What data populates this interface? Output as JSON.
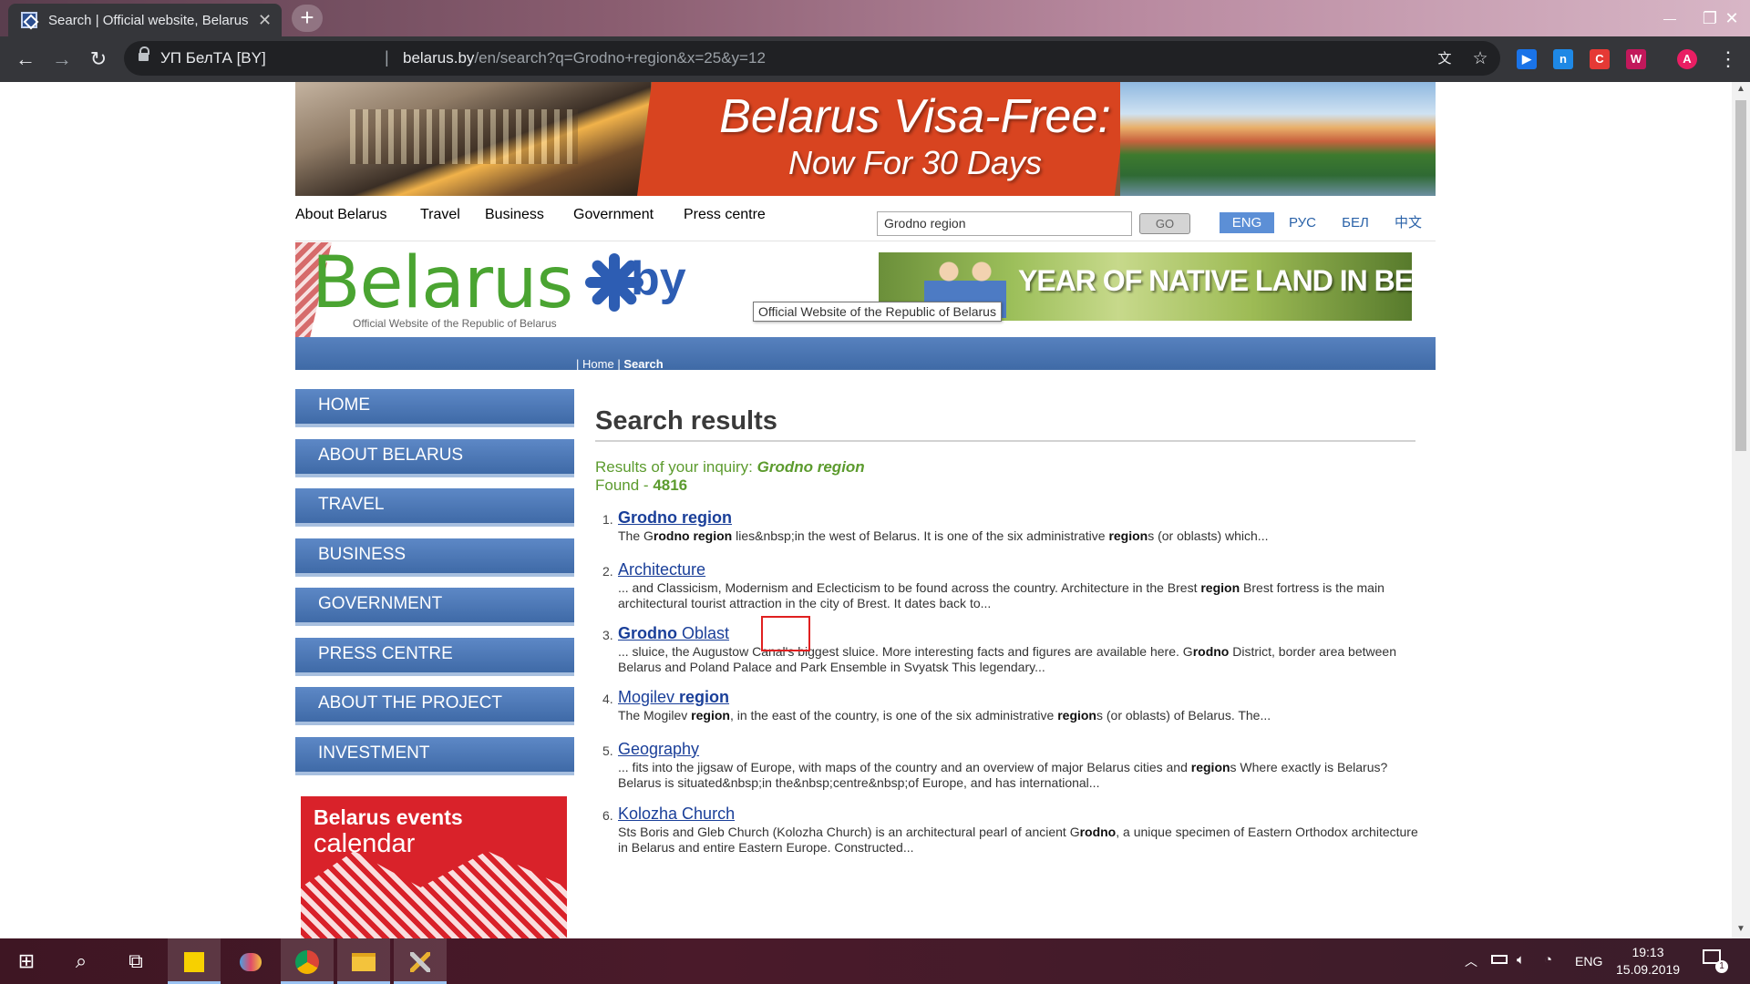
{
  "browser": {
    "tab_title": "Search | Official website, Belarus",
    "tab_close": "✕",
    "new_tab": "+",
    "window_controls": {
      "minimize": "—",
      "restore": "❐",
      "close": "✕"
    },
    "nav": {
      "back": "←",
      "forward": "→",
      "reload": "↻"
    },
    "site_org": "УП БелТА [BY]",
    "separator": "|",
    "url_host": "belarus.by",
    "url_path": "/en/search?q=Grodno+region&x=25&y=12",
    "icons": [
      "lock-icon",
      "translate-icon",
      "bookmark-star-icon",
      "profile-avatar"
    ],
    "translate_glyph": "文",
    "star_glyph": "☆",
    "menu_glyph": "⋮",
    "extensions": [
      {
        "name": "extension-play",
        "glyph": "▶",
        "color": "#1a73e8"
      },
      {
        "name": "extension-n",
        "glyph": "n",
        "color": "#1e88e5"
      },
      {
        "name": "extension-c",
        "glyph": "C",
        "color": "#e53935"
      },
      {
        "name": "extension-w",
        "glyph": "W",
        "color": "#c2185b"
      }
    ],
    "profile_initial": "A",
    "profile_color": "#e91e63"
  },
  "banner": {
    "line1": "Belarus Visa-Free:",
    "line2": "Now For 30 Days"
  },
  "topnav": {
    "items": [
      "About Belarus",
      "Travel",
      "Business",
      "Government",
      "Press centre"
    ]
  },
  "search": {
    "value": "Grodno region",
    "go_label": "GO"
  },
  "languages": [
    {
      "label": "ENG",
      "active": true
    },
    {
      "label": "РУС",
      "active": false
    },
    {
      "label": "БЕЛ",
      "active": false
    },
    {
      "label": "中文",
      "active": false
    }
  ],
  "logo": {
    "word": "Belarus",
    "by": "by",
    "tagline": "Official Website of the Republic of Belarus"
  },
  "tooltip": "Official Website of the Republic of Belarus",
  "year_banner": "YEAR OF NATIVE LAND IN BELARUS",
  "breadcrumb": {
    "sep": "|",
    "home": "Home",
    "current": "Search"
  },
  "sidebar": {
    "items": [
      "HOME",
      "ABOUT BELARUS",
      "TRAVEL",
      "BUSINESS",
      "GOVERNMENT",
      "PRESS CENTRE",
      "ABOUT THE PROJECT",
      "INVESTMENT"
    ]
  },
  "events_banner": {
    "line1": "Belarus events",
    "line2": "calendar"
  },
  "main": {
    "title": "Search results",
    "inquiry_label": "Results of your inquiry: ",
    "inquiry_value": "Grodno region",
    "found_label": "Found - ",
    "found_value": "4816"
  },
  "results": [
    {
      "num": "1.",
      "title_parts": [
        {
          "t": "Grodno region",
          "b": true
        }
      ],
      "snippet_parts": [
        {
          "t": "The G",
          "b": false
        },
        {
          "t": "rodno region",
          "b": true
        },
        {
          "t": " lies&nbsp;in the west of Belarus. It is one of the six administrative ",
          "b": false
        },
        {
          "t": "region",
          "b": true
        },
        {
          "t": "s (or oblasts) which...",
          "b": false
        }
      ]
    },
    {
      "num": "2.",
      "title_parts": [
        {
          "t": "Architecture",
          "b": false
        }
      ],
      "snippet_parts": [
        {
          "t": "... and Classicism, Modernism and Eclecticism to be found across the country. Architecture in the Brest ",
          "b": false
        },
        {
          "t": "region",
          "b": true
        },
        {
          "t": " Brest fortress is the main architectural tourist attraction in the city of Brest. It dates back to...",
          "b": false
        }
      ]
    },
    {
      "num": "3.",
      "title_parts": [
        {
          "t": "Grodno",
          "b": true
        },
        {
          "t": " Oblast",
          "b": false
        }
      ],
      "snippet_parts": [
        {
          "t": "... sluice, the Augustow Canal's biggest sluice. More interesting facts and figures are available here. G",
          "b": false
        },
        {
          "t": "rodno",
          "b": true
        },
        {
          "t": " District, border area between Belarus and Poland Palace and Park Ensemble in Svyatsk This legendary...",
          "b": false
        }
      ]
    },
    {
      "num": "4.",
      "title_parts": [
        {
          "t": "Mogilev ",
          "b": false
        },
        {
          "t": "region",
          "b": true
        }
      ],
      "snippet_parts": [
        {
          "t": "The Mogilev ",
          "b": false
        },
        {
          "t": "region",
          "b": true
        },
        {
          "t": ", in the east of the country, is one of the six administrative ",
          "b": false
        },
        {
          "t": "region",
          "b": true
        },
        {
          "t": "s (or oblasts) of Belarus. The...",
          "b": false
        }
      ]
    },
    {
      "num": "5.",
      "title_parts": [
        {
          "t": "Geography",
          "b": false
        }
      ],
      "snippet_parts": [
        {
          "t": "... fits into the jigsaw of Europe, with maps of the country and an overview of major Belarus cities and ",
          "b": false
        },
        {
          "t": "region",
          "b": true
        },
        {
          "t": "s Where exactly is Belarus? Belarus is situated&nbsp;in the&nbsp;centre&nbsp;of Europe, and has international...",
          "b": false
        }
      ]
    },
    {
      "num": "6.",
      "title_parts": [
        {
          "t": "Kolozha Church",
          "b": false
        }
      ],
      "snippet_parts": [
        {
          "t": "Sts Boris and Gleb Church (Kolozha Church) is an architectural pearl of ancient G",
          "b": false
        },
        {
          "t": "rodno",
          "b": true
        },
        {
          "t": ", a unique specimen of Eastern Orthodox architecture in Belarus and entire Eastern Europe. Constructed...",
          "b": false
        }
      ]
    }
  ],
  "taskbar": {
    "start": "⊞",
    "search": "⌕",
    "taskview": "⧉",
    "apps": [
      "sticky-notes-icon",
      "paint-icon",
      "chrome-icon",
      "file-explorer-icon",
      "tools-icon"
    ],
    "tray_arrow": "︿",
    "language": "ENG",
    "time": "19:13",
    "date": "15.09.2019",
    "notifications": "1"
  }
}
